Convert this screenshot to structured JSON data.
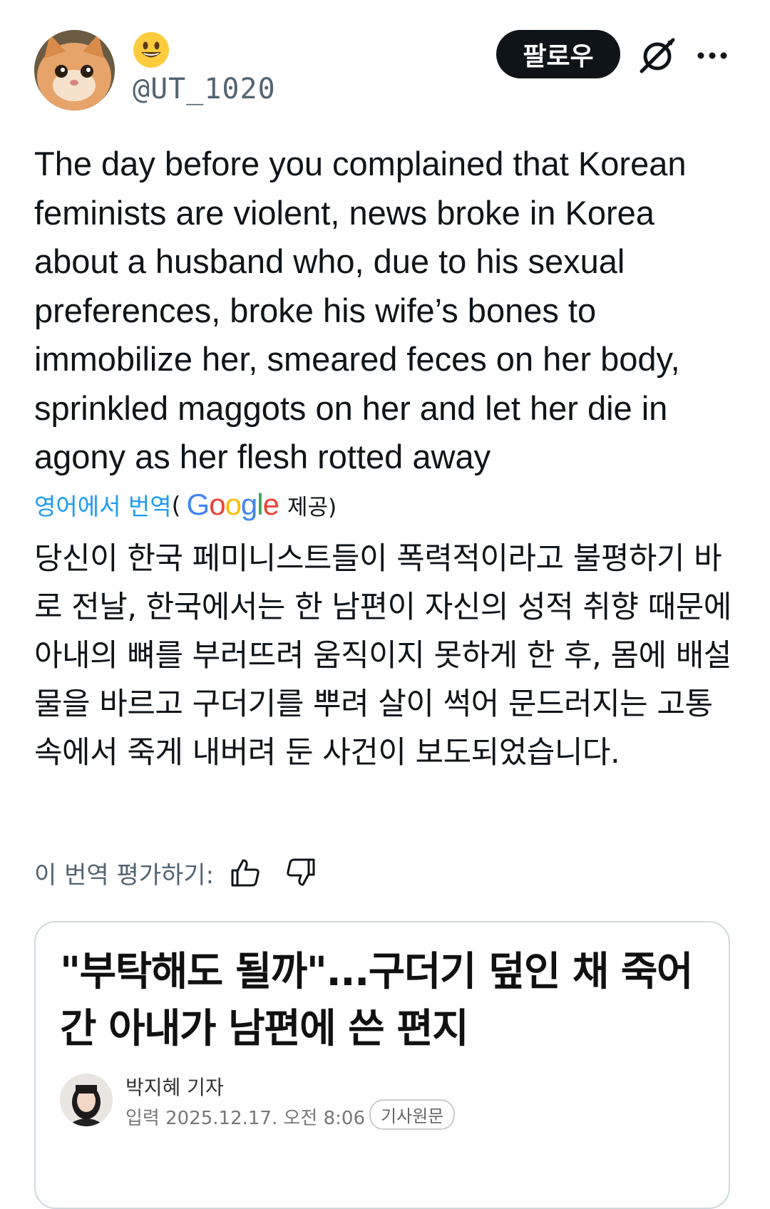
{
  "author": {
    "display_emoji": "😀",
    "handle": "@UT_1020"
  },
  "actions": {
    "follow_label": "팔로우"
  },
  "tweet": {
    "text": "The day before you complained that Korean feminists are violent, news broke in Korea about a husband who, due to his sexual preferences, broke his wife’s bones to immobilize her, smeared feces on her body, sprinkled maggots on her and let her die in agony as her flesh rotted away"
  },
  "translation": {
    "link_label": "영어에서 번역",
    "paren_open": "(",
    "provider": "Google",
    "provided_label": "제공)",
    "text": "당신이 한국 페미니스트들이 폭력적이라고 불평하기 바로 전날, 한국에서는 한 남편이 자신의 성적 취향 때문에 아내의 뼈를 부러뜨려 움직이지 못하게 한 후, 몸에 배설물을 바르고 구더기를 뿌려 살이 썩어 문드러지는 고통 속에서 죽게 내버려 둔 사건이 보도되었습니다.",
    "rate_label": "이 번역 평가하기:"
  },
  "card": {
    "headline": "\"부탁해도 될까\"...구더기 덮인 채 죽어간 아내가 남편에 쓴 편지",
    "reporter": "박지혜 기자",
    "date": "입력 2025.12.17. 오전 8:06",
    "original_label": "기사원문"
  },
  "colors": {
    "link": "#1d9bf0",
    "secondary_text": "#536471",
    "follow_bg": "#0f1419"
  },
  "icons": {
    "grok": "grok-icon",
    "more": "more-icon",
    "thumbs_up": "thumbs-up-icon",
    "thumbs_down": "thumbs-down-icon"
  }
}
